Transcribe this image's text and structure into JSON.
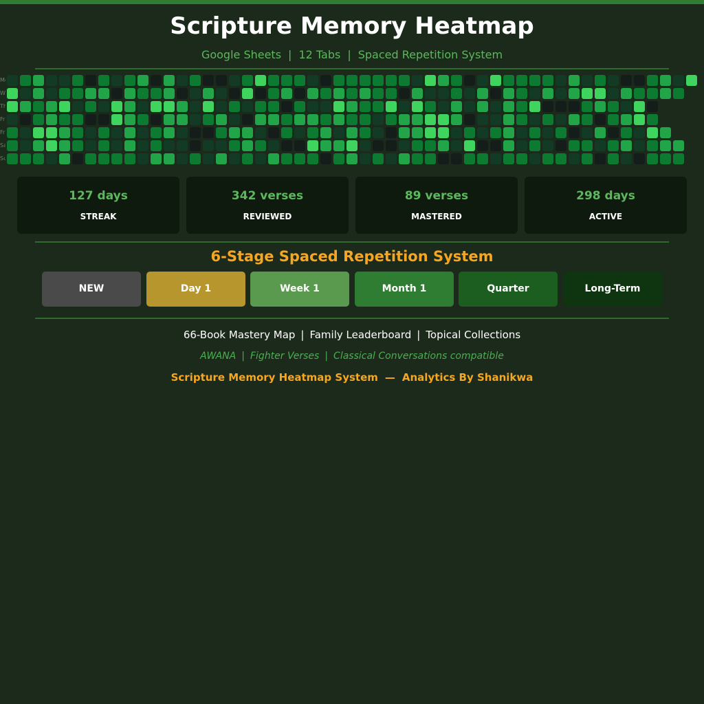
{
  "header": {
    "title": "Scripture Memory Heatmap",
    "subtitle_parts": [
      "Google Sheets",
      "12 Tabs",
      "Spaced Repetition System"
    ],
    "separator": "|"
  },
  "heatmap": {
    "day_labels": [
      "Mon",
      "Wed",
      "Thu",
      "Fri",
      "Fri",
      "Sat",
      "Sun"
    ],
    "palette": [
      "#141d1a",
      "#123a24",
      "#0d7a32",
      "#22a448",
      "#3fd45e"
    ],
    "grid": [
      [
        1,
        2,
        3,
        1,
        1,
        2,
        0,
        2,
        1,
        2,
        3,
        0,
        3,
        1,
        2,
        0,
        0,
        1,
        2,
        4,
        2,
        2,
        2,
        1,
        0,
        2,
        2,
        2,
        2,
        2,
        2,
        1,
        4,
        3,
        2,
        0,
        1,
        4,
        2,
        2,
        2,
        2,
        1,
        3,
        1,
        2,
        1,
        0,
        0,
        2,
        3,
        1,
        4
      ],
      [
        4,
        1,
        3,
        1,
        2,
        2,
        3,
        3,
        0,
        3,
        2,
        2,
        3,
        0,
        1,
        3,
        1,
        0,
        4,
        0,
        2,
        3,
        0,
        3,
        2,
        3,
        2,
        3,
        2,
        2,
        0,
        3,
        1,
        1,
        2,
        1,
        3,
        0,
        3,
        2,
        1,
        3,
        1,
        3,
        4,
        4,
        1,
        3,
        2,
        2,
        3,
        2
      ],
      [
        4,
        3,
        2,
        3,
        4,
        1,
        2,
        1,
        4,
        3,
        1,
        4,
        4,
        3,
        1,
        4,
        1,
        2,
        1,
        2,
        2,
        0,
        2,
        1,
        1,
        4,
        3,
        2,
        2,
        4,
        1,
        4,
        2,
        1,
        3,
        1,
        3,
        1,
        3,
        2,
        4,
        0,
        0,
        0,
        2,
        3,
        2,
        1,
        4,
        0
      ],
      [
        1,
        0,
        2,
        3,
        2,
        2,
        0,
        0,
        4,
        3,
        2,
        0,
        3,
        3,
        1,
        2,
        3,
        1,
        0,
        3,
        3,
        2,
        3,
        3,
        2,
        3,
        2,
        2,
        1,
        2,
        3,
        3,
        4,
        4,
        3,
        0,
        1,
        1,
        3,
        2,
        1,
        2,
        1,
        3,
        2,
        0,
        2,
        3,
        4,
        2
      ],
      [
        2,
        1,
        4,
        4,
        3,
        2,
        1,
        2,
        1,
        3,
        1,
        2,
        3,
        1,
        0,
        0,
        2,
        3,
        3,
        1,
        0,
        2,
        1,
        2,
        3,
        1,
        3,
        2,
        1,
        0,
        3,
        3,
        4,
        4,
        1,
        2,
        1,
        2,
        3,
        1,
        2,
        1,
        2,
        0,
        1,
        3,
        0,
        2,
        1,
        4,
        3
      ],
      [
        2,
        1,
        3,
        4,
        3,
        2,
        1,
        2,
        1,
        3,
        1,
        2,
        1,
        1,
        0,
        1,
        1,
        2,
        3,
        2,
        1,
        0,
        0,
        4,
        3,
        3,
        4,
        1,
        0,
        0,
        1,
        2,
        2,
        3,
        1,
        4,
        0,
        0,
        3,
        1,
        2,
        1,
        0,
        2,
        2,
        1,
        2,
        3,
        1,
        2,
        3,
        3
      ],
      [
        2,
        2,
        2,
        1,
        3,
        0,
        2,
        2,
        2,
        2,
        1,
        3,
        3,
        1,
        2,
        1,
        3,
        1,
        2,
        1,
        3,
        2,
        2,
        2,
        0,
        2,
        3,
        1,
        2,
        1,
        3,
        2,
        2,
        0,
        0,
        2,
        2,
        1,
        2,
        2,
        1,
        2,
        2,
        1,
        2,
        0,
        2,
        1,
        0,
        2,
        2,
        2
      ]
    ]
  },
  "stats": [
    {
      "value": "127 days",
      "label": "STREAK"
    },
    {
      "value": "342 verses",
      "label": "REVIEWED"
    },
    {
      "value": "89 verses",
      "label": "MASTERED"
    },
    {
      "value": "298 days",
      "label": "ACTIVE"
    }
  ],
  "stages": {
    "title": "6-Stage Spaced Repetition System",
    "items": [
      {
        "label": "NEW",
        "color": "#4a4a4a"
      },
      {
        "label": "Day 1",
        "color": "#b8962e"
      },
      {
        "label": "Week 1",
        "color": "#5a9a4e"
      },
      {
        "label": "Month 1",
        "color": "#2e7d32"
      },
      {
        "label": "Quarter",
        "color": "#1b5e20"
      },
      {
        "label": "Long-Term",
        "color": "#0f3510"
      }
    ]
  },
  "features": [
    "66-Book Mastery Map",
    "Family Leaderboard",
    "Topical Collections"
  ],
  "compatibility": [
    "AWANA",
    "Fighter Verses",
    "Classical Conversations compatible"
  ],
  "credit": {
    "left": "Scripture Memory Heatmap System",
    "dash": "—",
    "right": "Analytics By Shanikwa"
  }
}
